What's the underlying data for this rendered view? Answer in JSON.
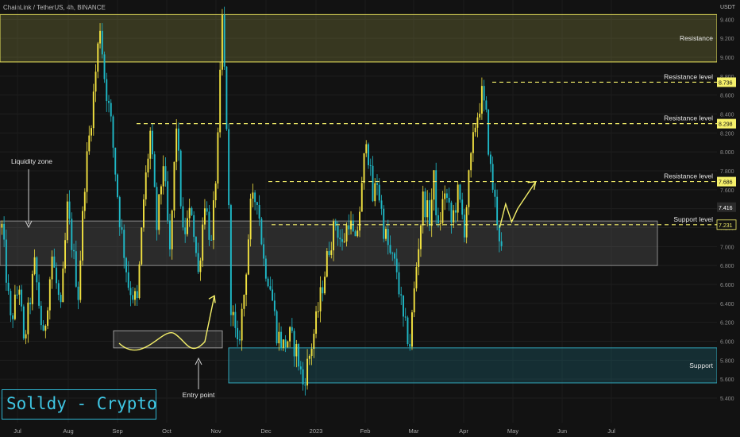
{
  "header": {
    "symbol_line": "ChainLink / TetherUS, 4h, BINANCE"
  },
  "watermark": "Solldy - Crypto for U",
  "chart_data": {
    "type": "candlestick",
    "currency": "USDT",
    "ylim": [
      5.4,
      9.5
    ],
    "y_ticks": [
      5.4,
      5.6,
      5.8,
      6.0,
      6.2,
      6.4,
      6.6,
      6.8,
      7.0,
      7.2,
      7.4,
      7.6,
      7.8,
      8.0,
      8.2,
      8.4,
      8.6,
      8.8,
      9.0,
      9.2,
      9.4
    ],
    "x_labels": [
      "Jul",
      "Aug",
      "Sep",
      "Oct",
      "Nov",
      "Dec",
      "2023",
      "Feb",
      "Mar",
      "Apr",
      "May",
      "Jun",
      "Jul"
    ],
    "colors": {
      "up": "#f0e040",
      "down": "#1fb8c6",
      "level": "#f5f06a",
      "support": "#31a5b8",
      "arrow": "#f5f06a",
      "text": "#e6e6e6"
    },
    "price_path": [
      [
        0,
        7.2
      ],
      [
        4,
        6.2
      ],
      [
        8,
        6.6
      ],
      [
        10,
        5.95
      ],
      [
        15,
        6.8
      ],
      [
        19,
        6.0
      ],
      [
        23,
        6.9
      ],
      [
        27,
        6.3
      ],
      [
        30,
        7.4
      ],
      [
        35,
        6.5
      ],
      [
        38,
        7.7
      ],
      [
        42,
        8.6
      ],
      [
        45,
        9.35
      ],
      [
        47,
        8.8
      ],
      [
        50,
        8.3
      ],
      [
        54,
        7.3
      ],
      [
        58,
        6.6
      ],
      [
        62,
        6.4
      ],
      [
        65,
        7.5
      ],
      [
        68,
        8.2
      ],
      [
        71,
        7.2
      ],
      [
        74,
        7.9
      ],
      [
        77,
        6.9
      ],
      [
        80,
        8.3
      ],
      [
        83,
        7.1
      ],
      [
        87,
        7.4
      ],
      [
        90,
        6.7
      ],
      [
        93,
        7.5
      ],
      [
        96,
        7.0
      ],
      [
        99,
        8.1
      ],
      [
        101,
        9.4
      ],
      [
        103,
        8.3
      ],
      [
        105,
        6.4
      ],
      [
        108,
        5.9
      ],
      [
        111,
        6.5
      ],
      [
        114,
        7.4
      ],
      [
        117,
        7.55
      ],
      [
        120,
        6.85
      ],
      [
        123,
        6.6
      ],
      [
        126,
        6.1
      ],
      [
        129,
        5.95
      ],
      [
        132,
        6.05
      ],
      [
        135,
        5.9
      ],
      [
        138,
        5.55
      ],
      [
        141,
        5.85
      ],
      [
        144,
        6.2
      ],
      [
        147,
        6.6
      ],
      [
        150,
        7.0
      ],
      [
        153,
        7.25
      ],
      [
        156,
        7.0
      ],
      [
        159,
        7.3
      ],
      [
        162,
        7.0
      ],
      [
        165,
        7.6
      ],
      [
        167,
        8.2
      ],
      [
        170,
        7.5
      ],
      [
        172,
        7.7
      ],
      [
        175,
        7.2
      ],
      [
        178,
        6.9
      ],
      [
        181,
        6.75
      ],
      [
        184,
        6.2
      ],
      [
        187,
        5.98
      ],
      [
        190,
        6.8
      ],
      [
        193,
        7.5
      ],
      [
        196,
        7.3
      ],
      [
        198,
        7.7
      ],
      [
        200,
        7.15
      ],
      [
        203,
        7.6
      ],
      [
        206,
        7.25
      ],
      [
        209,
        7.55
      ],
      [
        212,
        7.2
      ],
      [
        214,
        7.7
      ],
      [
        217,
        8.3
      ],
      [
        220,
        8.6
      ],
      [
        222,
        8.35
      ],
      [
        224,
        7.8
      ],
      [
        227,
        7.3
      ],
      [
        229,
        6.95
      ]
    ],
    "forecast_arrow": [
      [
        7.3,
        7.2
      ],
      [
        7.35,
        7.45
      ],
      [
        7.4,
        7.26
      ],
      [
        7.45,
        7.4
      ],
      [
        7.6,
        7.685
      ]
    ],
    "entry_curve_arrow": {
      "from": 6.2,
      "to": 6.48
    },
    "price_labels": [
      {
        "value": 8.736,
        "text": "8.736",
        "style": "light"
      },
      {
        "value": 8.298,
        "text": "8.298",
        "style": "light"
      },
      {
        "value": 7.686,
        "text": "7.686",
        "style": "light"
      },
      {
        "value": 7.416,
        "text": "7.416",
        "style": "dark"
      },
      {
        "value": 7.231,
        "text": "7.231",
        "style": "box"
      }
    ],
    "levels": [
      {
        "value": 8.736,
        "label": "Resistance level"
      },
      {
        "value": 8.298,
        "label": "Resistance level"
      },
      {
        "value": 7.686,
        "label": "Resistance level"
      },
      {
        "value": 7.231,
        "label": "Support level"
      }
    ],
    "zones": [
      {
        "name": "resistance",
        "label": "Resistance",
        "top": 9.45,
        "bottom": 8.95
      },
      {
        "name": "liquidity",
        "label": "Liquidity zone",
        "top": 7.27,
        "bottom": 6.8
      },
      {
        "name": "support",
        "label": "Support",
        "top": 5.93,
        "bottom": 5.56
      },
      {
        "name": "entry",
        "label": "Entry point",
        "top": 6.11,
        "bottom": 5.93
      }
    ]
  }
}
